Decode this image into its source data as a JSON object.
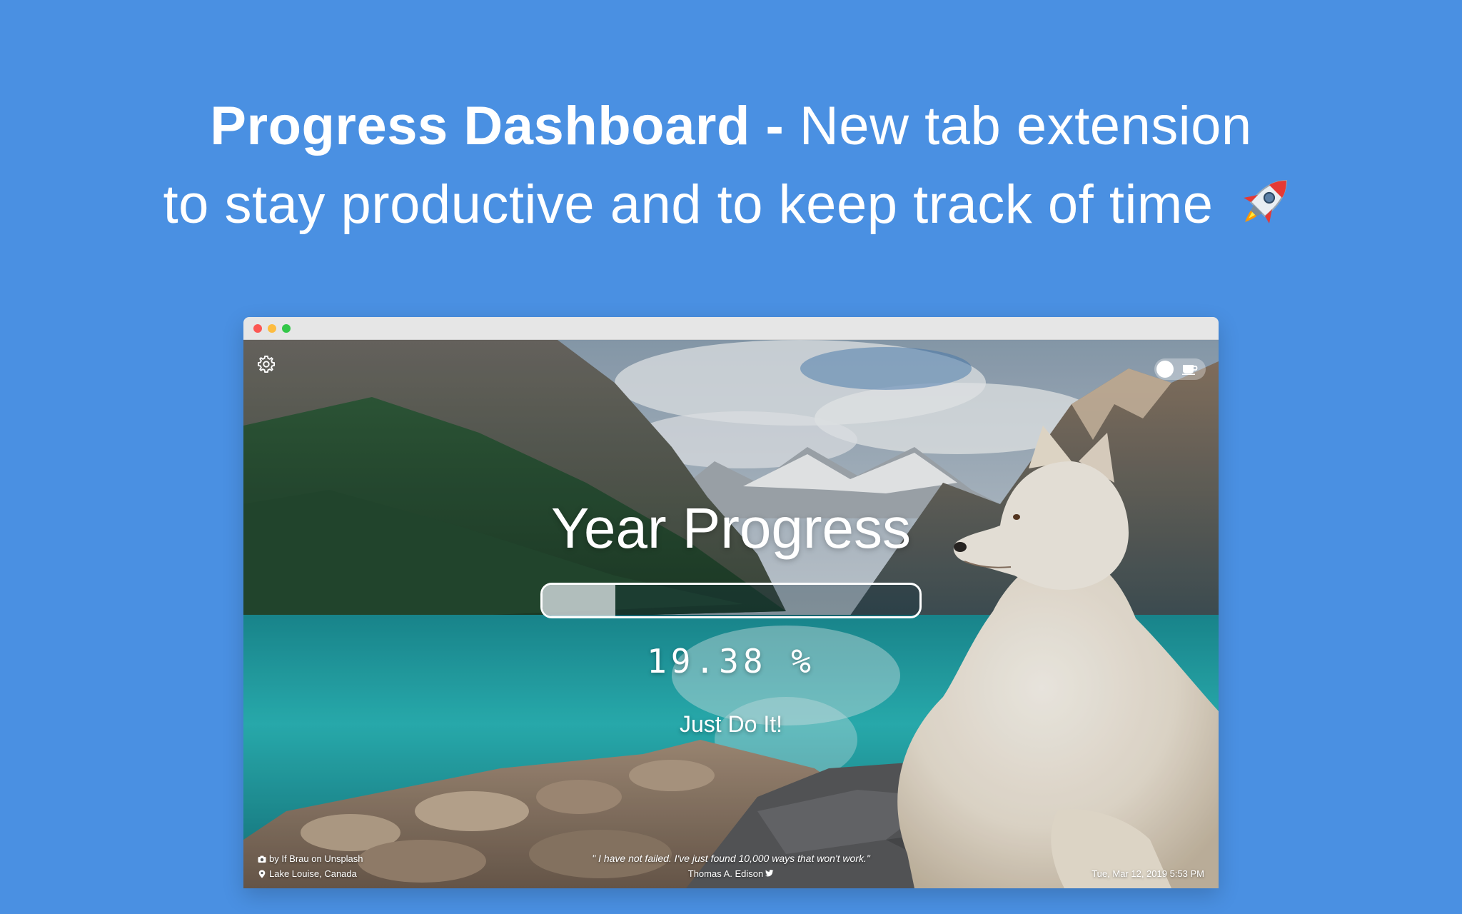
{
  "headline": {
    "bold": "Progress Dashboard -",
    "light": "New tab extension",
    "line2": "to stay productive and to keep track of time",
    "emoji_icon": "rocket-icon"
  },
  "window": {
    "controls": [
      "close",
      "minimize",
      "maximize"
    ]
  },
  "dashboard": {
    "title": "Year Progress",
    "progress_fraction": 0.1938,
    "percent_text": "19.38 %",
    "motto": "Just Do It!",
    "photo_credit": "by If Brau on Unsplash",
    "location": "Lake Louise, Canada",
    "quote": "\" I have not failed. I've just found 10,000 ways that won't work.\"",
    "quote_author": "Thomas A. Edison",
    "datetime": "Tue, Mar 12, 2019 5:53 PM",
    "icons": {
      "settings": "gear-icon",
      "toggle": "coffee-toggle",
      "camera": "camera-icon",
      "location": "location-pin-icon",
      "share": "twitter-icon"
    }
  },
  "colors": {
    "background": "#4a90e2",
    "text": "#ffffff"
  }
}
